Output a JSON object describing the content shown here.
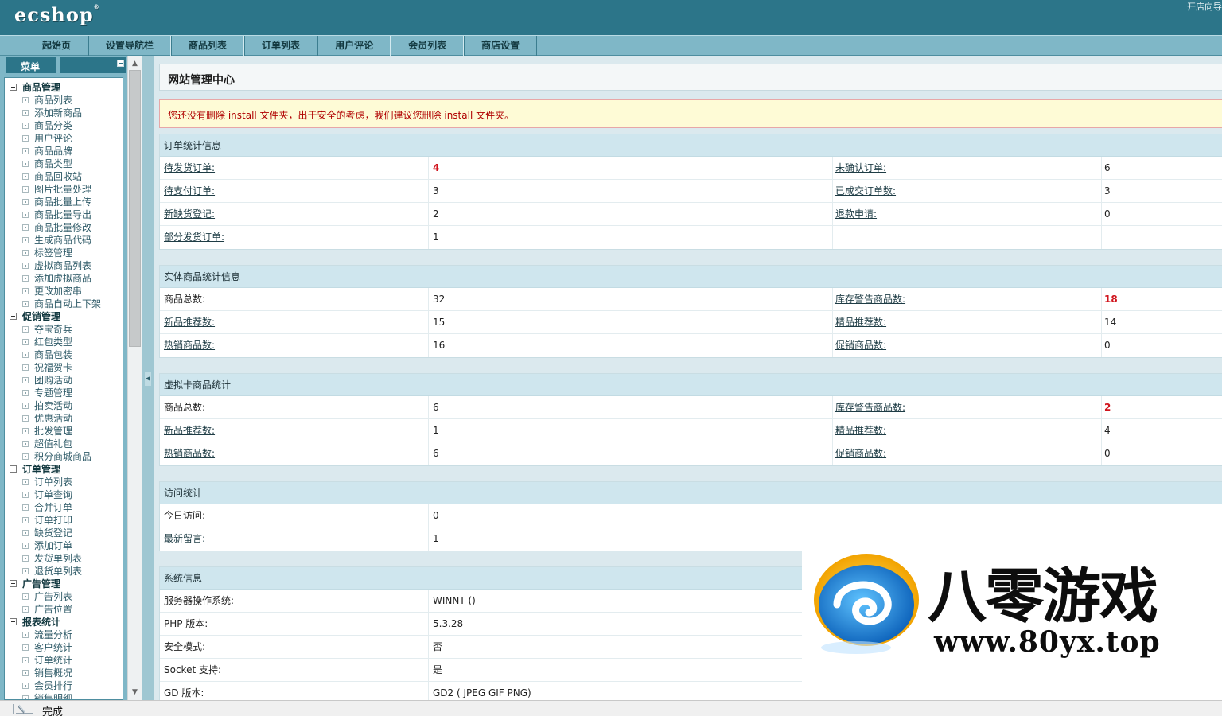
{
  "header": {
    "logo": "ecshop",
    "logo_mark": "®",
    "right_link": "开店向导"
  },
  "nav": {
    "tabs": [
      "起始页",
      "设置导航栏",
      "商品列表",
      "订单列表",
      "用户评论",
      "会员列表",
      "商店设置"
    ]
  },
  "menu": {
    "title": "菜单",
    "groups": [
      {
        "name": "商品管理",
        "items": [
          "商品列表",
          "添加新商品",
          "商品分类",
          "用户评论",
          "商品品牌",
          "商品类型",
          "商品回收站",
          "图片批量处理",
          "商品批量上传",
          "商品批量导出",
          "商品批量修改",
          "生成商品代码",
          "标签管理",
          "虚拟商品列表",
          "添加虚拟商品",
          "更改加密串",
          "商品自动上下架"
        ]
      },
      {
        "name": "促销管理",
        "items": [
          "夺宝奇兵",
          "红包类型",
          "商品包装",
          "祝福贺卡",
          "团购活动",
          "专题管理",
          "拍卖活动",
          "优惠活动",
          "批发管理",
          "超值礼包",
          "积分商城商品"
        ]
      },
      {
        "name": "订单管理",
        "items": [
          "订单列表",
          "订单查询",
          "合并订单",
          "订单打印",
          "缺货登记",
          "添加订单",
          "发货单列表",
          "退货单列表"
        ]
      },
      {
        "name": "广告管理",
        "items": [
          "广告列表",
          "广告位置"
        ]
      },
      {
        "name": "报表统计",
        "items": [
          "流量分析",
          "客户统计",
          "订单统计",
          "销售概况",
          "会员排行",
          "销售明细"
        ]
      }
    ]
  },
  "main": {
    "page_title": "网站管理中心",
    "warning": "您还没有删除 install 文件夹，出于安全的考虑，我们建议您删除 install 文件夹。",
    "order_stats": {
      "title": "订单统计信息",
      "rows": [
        {
          "l1": "待发货订单:",
          "v1": "4",
          "l2": "未确认订单:",
          "v2": "6"
        },
        {
          "l1": "待支付订单:",
          "v1": "3",
          "l2": "已成交订单数:",
          "v2": "3"
        },
        {
          "l1": "新缺货登记:",
          "v1": "2",
          "l2": "退款申请:",
          "v2": "0"
        },
        {
          "l1": "部分发货订单:",
          "v1": "1",
          "l2": "",
          "v2": ""
        }
      ]
    },
    "goods_stats": {
      "title": "实体商品统计信息",
      "rows": [
        {
          "l1": "商品总数:",
          "v1": "32",
          "l2": "库存警告商品数:",
          "v2": "18"
        },
        {
          "l1": "新品推荐数:",
          "v1": "15",
          "l2": "精品推荐数:",
          "v2": "14"
        },
        {
          "l1": "热销商品数:",
          "v1": "16",
          "l2": "促销商品数:",
          "v2": "0"
        }
      ]
    },
    "virtual_stats": {
      "title": "虚拟卡商品统计",
      "rows": [
        {
          "l1": "商品总数:",
          "v1": "6",
          "l2": "库存警告商品数:",
          "v2": "2"
        },
        {
          "l1": "新品推荐数:",
          "v1": "1",
          "l2": "精品推荐数:",
          "v2": "4"
        },
        {
          "l1": "热销商品数:",
          "v1": "6",
          "l2": "促销商品数:",
          "v2": "0"
        }
      ]
    },
    "visit_stats": {
      "title": "访问统计",
      "rows": [
        {
          "l1": "今日访问:",
          "v1": "0"
        },
        {
          "l1": "最新留言:",
          "v1": "1"
        }
      ]
    },
    "system_info": {
      "title": "系统信息",
      "rows": [
        {
          "l1": "服务器操作系统:",
          "v1": "WINNT ()"
        },
        {
          "l1": "PHP 版本:",
          "v1": "5.3.28"
        },
        {
          "l1": "安全模式:",
          "v1": "否"
        },
        {
          "l1": "Socket 支持:",
          "v1": "是"
        },
        {
          "l1": "GD 版本:",
          "v1": "GD2 ( JPEG GIF PNG)"
        }
      ]
    }
  },
  "watermark": {
    "big_text": "八零游戏",
    "url": "www.80yx.top"
  },
  "status": {
    "text": "完成"
  },
  "colors": {
    "header": "#2c7589",
    "nav": "#7fb7c7",
    "section_head": "#cfe6ee",
    "alert_red": "#d0141d"
  },
  "icons": {
    "collapse": "minus-box-icon",
    "tree_group": "minus-box-icon",
    "tree_item": "dot-box-icon",
    "status": "ie-status-icon"
  }
}
